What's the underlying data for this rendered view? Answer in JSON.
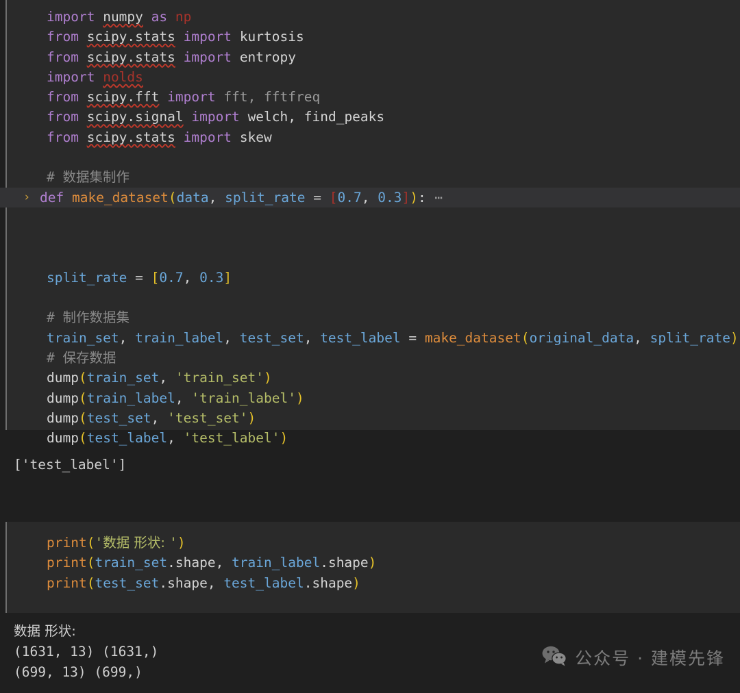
{
  "app": {
    "type": "jupyter-notebook",
    "theme": "dark",
    "colors": {
      "page_background": "#1f1f1f",
      "code_cell_background": "#2a2a2a",
      "cell_border": "#6e6e6e",
      "folded_line_highlight": "#333335",
      "keyword": "#b07fd0",
      "function": "#dd8c3c",
      "variable": "#6aa6d8",
      "string": "#b5bd68",
      "bracket": "#e6c229",
      "comment": "#8a8a8a",
      "error": "#a8332b",
      "text": "#d4d4d4"
    }
  },
  "cell_1": {
    "lines": [
      {
        "id": "l01",
        "tokens": [
          {
            "t": "import",
            "c": "kw"
          },
          {
            "t": " ",
            "c": "op"
          },
          {
            "t": "numpy",
            "c": "mod squiggle"
          },
          {
            "t": " ",
            "c": "op"
          },
          {
            "t": "as",
            "c": "kw"
          },
          {
            "t": " ",
            "c": "op"
          },
          {
            "t": "np",
            "c": "err"
          }
        ]
      },
      {
        "id": "l02",
        "tokens": [
          {
            "t": "from",
            "c": "kw"
          },
          {
            "t": " ",
            "c": "op"
          },
          {
            "t": "scipy.stats",
            "c": "mod squiggle"
          },
          {
            "t": " ",
            "c": "op"
          },
          {
            "t": "import",
            "c": "kw"
          },
          {
            "t": " ",
            "c": "op"
          },
          {
            "t": "kurtosis",
            "c": "name"
          }
        ]
      },
      {
        "id": "l03",
        "tokens": [
          {
            "t": "from",
            "c": "kw"
          },
          {
            "t": " ",
            "c": "op"
          },
          {
            "t": "scipy.stats",
            "c": "mod squiggle"
          },
          {
            "t": " ",
            "c": "op"
          },
          {
            "t": "import",
            "c": "kw"
          },
          {
            "t": " ",
            "c": "op"
          },
          {
            "t": "entropy",
            "c": "name"
          }
        ]
      },
      {
        "id": "l04",
        "tokens": [
          {
            "t": "import",
            "c": "kw"
          },
          {
            "t": " ",
            "c": "op"
          },
          {
            "t": "nolds",
            "c": "err squiggle-err"
          }
        ]
      },
      {
        "id": "l05",
        "tokens": [
          {
            "t": "from",
            "c": "kw"
          },
          {
            "t": " ",
            "c": "op"
          },
          {
            "t": "scipy.fft",
            "c": "mod squiggle"
          },
          {
            "t": " ",
            "c": "op"
          },
          {
            "t": "import",
            "c": "kw"
          },
          {
            "t": " ",
            "c": "op"
          },
          {
            "t": "fft, fftfreq",
            "c": "dim"
          }
        ]
      },
      {
        "id": "l06",
        "tokens": [
          {
            "t": "from",
            "c": "kw"
          },
          {
            "t": " ",
            "c": "op"
          },
          {
            "t": "scipy.signal",
            "c": "mod squiggle"
          },
          {
            "t": " ",
            "c": "op"
          },
          {
            "t": "import",
            "c": "kw"
          },
          {
            "t": " ",
            "c": "op"
          },
          {
            "t": "welch, find_peaks",
            "c": "name"
          }
        ]
      },
      {
        "id": "l07",
        "tokens": [
          {
            "t": "from",
            "c": "kw"
          },
          {
            "t": " ",
            "c": "op"
          },
          {
            "t": "scipy.stats",
            "c": "mod squiggle"
          },
          {
            "t": " ",
            "c": "op"
          },
          {
            "t": "import",
            "c": "kw"
          },
          {
            "t": " ",
            "c": "op"
          },
          {
            "t": "skew",
            "c": "name"
          }
        ]
      },
      {
        "id": "l08",
        "tokens": []
      },
      {
        "id": "l09",
        "tokens": [
          {
            "t": "# ",
            "c": "cmt"
          },
          {
            "t": "数据集制作",
            "c": "cmt cjk"
          }
        ]
      },
      {
        "id": "l10",
        "folded": true,
        "chevron": "›",
        "ellipsis": "⋯",
        "tokens": [
          {
            "t": "def",
            "c": "kw"
          },
          {
            "t": " ",
            "c": "op"
          },
          {
            "t": "make_dataset",
            "c": "fn"
          },
          {
            "t": "(",
            "c": "paren"
          },
          {
            "t": "data",
            "c": "var"
          },
          {
            "t": ", ",
            "c": "punct"
          },
          {
            "t": "split_rate",
            "c": "var"
          },
          {
            "t": " ",
            "c": "op"
          },
          {
            "t": "=",
            "c": "op"
          },
          {
            "t": " ",
            "c": "op"
          },
          {
            "t": "[",
            "c": "err"
          },
          {
            "t": "0.7",
            "c": "num"
          },
          {
            "t": ", ",
            "c": "punct"
          },
          {
            "t": "0.3",
            "c": "num"
          },
          {
            "t": "]",
            "c": "err"
          },
          {
            "t": ")",
            "c": "paren"
          },
          {
            "t": ":",
            "c": "punct"
          }
        ]
      },
      {
        "id": "l11",
        "tokens": []
      },
      {
        "id": "l12",
        "tokens": []
      },
      {
        "id": "l13",
        "tokens": []
      },
      {
        "id": "l14",
        "tokens": [
          {
            "t": "split_rate",
            "c": "var"
          },
          {
            "t": " ",
            "c": "op"
          },
          {
            "t": "=",
            "c": "op"
          },
          {
            "t": " ",
            "c": "op"
          },
          {
            "t": "[",
            "c": "paren"
          },
          {
            "t": "0.7",
            "c": "num"
          },
          {
            "t": ", ",
            "c": "punct"
          },
          {
            "t": "0.3",
            "c": "num"
          },
          {
            "t": "]",
            "c": "paren"
          }
        ]
      },
      {
        "id": "l15",
        "tokens": []
      },
      {
        "id": "l16",
        "tokens": [
          {
            "t": "# ",
            "c": "cmt"
          },
          {
            "t": "制作数据集",
            "c": "cmt cjk"
          }
        ]
      },
      {
        "id": "l17",
        "tokens": [
          {
            "t": "train_set",
            "c": "var"
          },
          {
            "t": ", ",
            "c": "punct"
          },
          {
            "t": "train_label",
            "c": "var"
          },
          {
            "t": ", ",
            "c": "punct"
          },
          {
            "t": "test_set",
            "c": "var"
          },
          {
            "t": ", ",
            "c": "punct"
          },
          {
            "t": "test_label",
            "c": "var"
          },
          {
            "t": " ",
            "c": "op"
          },
          {
            "t": "=",
            "c": "op"
          },
          {
            "t": " ",
            "c": "op"
          },
          {
            "t": "make_dataset",
            "c": "fn"
          },
          {
            "t": "(",
            "c": "paren"
          },
          {
            "t": "original_data",
            "c": "var"
          },
          {
            "t": ", ",
            "c": "punct"
          },
          {
            "t": "split_rate",
            "c": "var"
          },
          {
            "t": ")",
            "c": "paren"
          }
        ]
      },
      {
        "id": "l18",
        "tokens": [
          {
            "t": "# ",
            "c": "cmt"
          },
          {
            "t": "保存数据",
            "c": "cmt cjk"
          }
        ]
      },
      {
        "id": "l19",
        "tokens": [
          {
            "t": "dump",
            "c": "name"
          },
          {
            "t": "(",
            "c": "paren"
          },
          {
            "t": "train_set",
            "c": "var"
          },
          {
            "t": ", ",
            "c": "punct"
          },
          {
            "t": "'train_set'",
            "c": "str"
          },
          {
            "t": ")",
            "c": "paren"
          }
        ]
      },
      {
        "id": "l20",
        "tokens": [
          {
            "t": "dump",
            "c": "name"
          },
          {
            "t": "(",
            "c": "paren"
          },
          {
            "t": "train_label",
            "c": "var"
          },
          {
            "t": ", ",
            "c": "punct"
          },
          {
            "t": "'train_label'",
            "c": "str"
          },
          {
            "t": ")",
            "c": "paren"
          }
        ]
      },
      {
        "id": "l21",
        "tokens": [
          {
            "t": "dump",
            "c": "name"
          },
          {
            "t": "(",
            "c": "paren"
          },
          {
            "t": "test_set",
            "c": "var"
          },
          {
            "t": ", ",
            "c": "punct"
          },
          {
            "t": "'test_set'",
            "c": "str"
          },
          {
            "t": ")",
            "c": "paren"
          }
        ]
      },
      {
        "id": "l22",
        "tokens": [
          {
            "t": "dump",
            "c": "name"
          },
          {
            "t": "(",
            "c": "paren"
          },
          {
            "t": "test_label",
            "c": "var"
          },
          {
            "t": ", ",
            "c": "punct"
          },
          {
            "t": "'test_label'",
            "c": "str"
          },
          {
            "t": ")",
            "c": "paren"
          }
        ]
      }
    ]
  },
  "output_1": {
    "lines": [
      "['test_label']"
    ]
  },
  "cell_2": {
    "lines": [
      {
        "id": "m01",
        "tokens": [
          {
            "t": "print",
            "c": "fn"
          },
          {
            "t": "(",
            "c": "paren"
          },
          {
            "t": "'",
            "c": "str"
          },
          {
            "t": "数据 形状: ",
            "c": "str cjk"
          },
          {
            "t": "'",
            "c": "str"
          },
          {
            "t": ")",
            "c": "paren"
          }
        ]
      },
      {
        "id": "m02",
        "tokens": [
          {
            "t": "print",
            "c": "fn"
          },
          {
            "t": "(",
            "c": "paren"
          },
          {
            "t": "train_set",
            "c": "var"
          },
          {
            "t": ".",
            "c": "punct"
          },
          {
            "t": "shape",
            "c": "attr"
          },
          {
            "t": ", ",
            "c": "punct"
          },
          {
            "t": "train_label",
            "c": "var"
          },
          {
            "t": ".",
            "c": "punct"
          },
          {
            "t": "shape",
            "c": "attr"
          },
          {
            "t": ")",
            "c": "paren"
          }
        ]
      },
      {
        "id": "m03",
        "tokens": [
          {
            "t": "print",
            "c": "fn"
          },
          {
            "t": "(",
            "c": "paren"
          },
          {
            "t": "test_set",
            "c": "var"
          },
          {
            "t": ".",
            "c": "punct"
          },
          {
            "t": "shape",
            "c": "attr"
          },
          {
            "t": ", ",
            "c": "punct"
          },
          {
            "t": "test_label",
            "c": "var"
          },
          {
            "t": ".",
            "c": "punct"
          },
          {
            "t": "shape",
            "c": "attr"
          },
          {
            "t": ")",
            "c": "paren"
          }
        ]
      }
    ]
  },
  "output_2": {
    "lines": [
      {
        "text": "数据 形状:",
        "cjk": true
      },
      {
        "text": "(1631, 13) (1631,)",
        "cjk": false
      },
      {
        "text": "(699, 13) (699,)",
        "cjk": false
      }
    ]
  },
  "watermark": {
    "icon": "wechat-icon",
    "text": "公众号 · 建模先锋"
  }
}
